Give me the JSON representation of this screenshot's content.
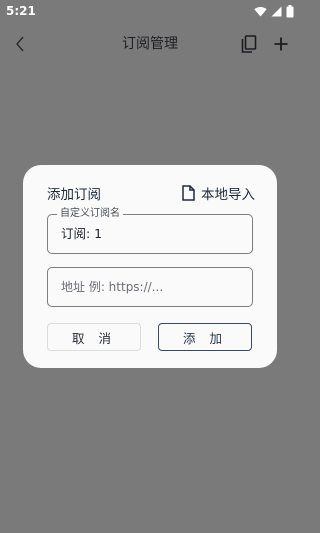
{
  "status_bar": {
    "time": "5:21"
  },
  "app_bar": {
    "title": "订阅管理"
  },
  "dialog": {
    "title": "添加订阅",
    "local_import_label": "本地导入",
    "name_field": {
      "label": "自定义订阅名",
      "value": "订阅: 1"
    },
    "url_field": {
      "placeholder": "地址 例: https://..."
    },
    "cancel_label": "取 消",
    "add_label": "添 加"
  },
  "colors": {
    "scrim": "#7a7a7a",
    "dialog_bg": "#fafafa",
    "accent": "#2a3852"
  }
}
